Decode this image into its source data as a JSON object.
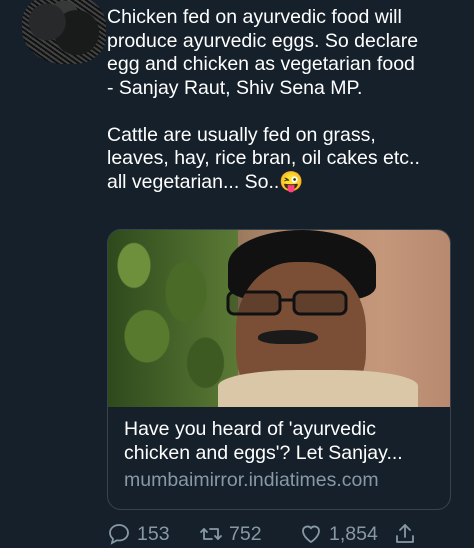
{
  "tweet": {
    "text": "Chicken fed on ayurvedic food will\nproduce ayurvedic eggs. So declare\negg and chicken as vegetarian food\n- Sanjay Raut, Shiv Sena MP.\n\nCattle are usually fed on grass,\nleaves, hay, rice bran, oil cakes etc..\nall vegetarian... So..😜"
  },
  "card": {
    "title": "Have you heard of 'ayurvedic chicken and eggs'? Let Sanjay...",
    "domain": "mumbaimirror.indiatimes.com"
  },
  "actions": {
    "replies": "153",
    "retweets": "752",
    "likes": "1,854"
  },
  "colors": {
    "background": "#15202b",
    "secondary_text": "#8899a6",
    "border": "#38444d"
  },
  "icons": [
    "reply-icon",
    "retweet-icon",
    "like-icon",
    "share-icon"
  ]
}
